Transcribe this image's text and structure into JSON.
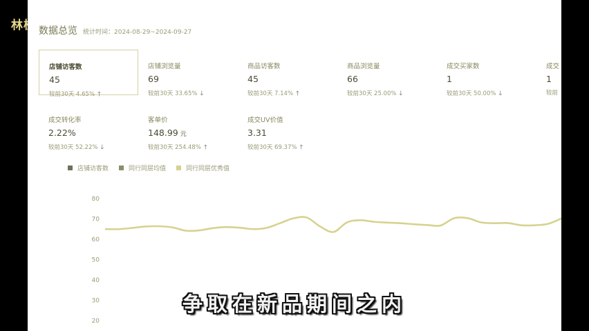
{
  "channel": {
    "logo_text": "林栊"
  },
  "dashboard": {
    "title": "数据总览",
    "stat_period": "统计时间：2024-08-29~2024-09-27",
    "cards": [
      {
        "label": "店铺访客数",
        "value": "45",
        "unit": "",
        "compare_label": "较前30天",
        "compare_value": "4.65%",
        "trend": "up",
        "selected": true
      },
      {
        "label": "店铺浏览量",
        "value": "69",
        "unit": "",
        "compare_label": "较前30天",
        "compare_value": "33.65%",
        "trend": "down",
        "selected": false
      },
      {
        "label": "商品访客数",
        "value": "45",
        "unit": "",
        "compare_label": "较前30天",
        "compare_value": "7.14%",
        "trend": "up",
        "selected": false
      },
      {
        "label": "商品浏览量",
        "value": "66",
        "unit": "",
        "compare_label": "较前30天",
        "compare_value": "25.00%",
        "trend": "down",
        "selected": false
      },
      {
        "label": "成交买家数",
        "value": "1",
        "unit": "",
        "compare_label": "较前30天",
        "compare_value": "50.00%",
        "trend": "down",
        "selected": false
      },
      {
        "label": "成交",
        "value": "1",
        "unit": "",
        "compare_label": "较前",
        "compare_value": "",
        "trend": "",
        "selected": false
      },
      {
        "label": "成交转化率",
        "value": "2.22%",
        "unit": "",
        "compare_label": "较前30天",
        "compare_value": "52.22%",
        "trend": "down",
        "selected": false
      },
      {
        "label": "客单价",
        "value": "148.99",
        "unit": "元",
        "compare_label": "较前30天",
        "compare_value": "254.48%",
        "trend": "up",
        "selected": false
      },
      {
        "label": "成交UV价值",
        "value": "3.31",
        "unit": "",
        "compare_label": "较前30天",
        "compare_value": "69.37%",
        "trend": "up",
        "selected": false
      }
    ],
    "legend": [
      {
        "label": "店铺访客数",
        "color": "#6e7256"
      },
      {
        "label": "同行同层均值",
        "color": "#8a8f6a"
      },
      {
        "label": "同行同层优秀值",
        "color": "#d6d28f"
      }
    ],
    "trend_up_symbol": "🡑",
    "trend_down_symbol": "🡓"
  },
  "chart_data": {
    "type": "line",
    "yticks": [
      "80",
      "70",
      "60",
      "50",
      "40",
      "30",
      "20"
    ],
    "ylim": [
      20,
      80
    ],
    "series": [
      {
        "name": "同行同层优秀值",
        "color": "#d6d28f",
        "values": [
          65,
          65,
          65.6,
          66.3,
          66.4,
          65.8,
          64.2,
          64.4,
          65.5,
          66,
          65.7,
          65,
          65.6,
          67.9,
          70.3,
          70.7,
          66.3,
          63.6,
          68.3,
          69.4,
          68.6,
          68.2,
          67.9,
          67.4,
          67,
          66.8,
          70.4,
          70.4,
          68.3,
          67.9,
          68,
          66.9,
          66.9,
          67.6,
          70.2
        ]
      }
    ]
  },
  "subtitle": "争取在新品期间之内"
}
